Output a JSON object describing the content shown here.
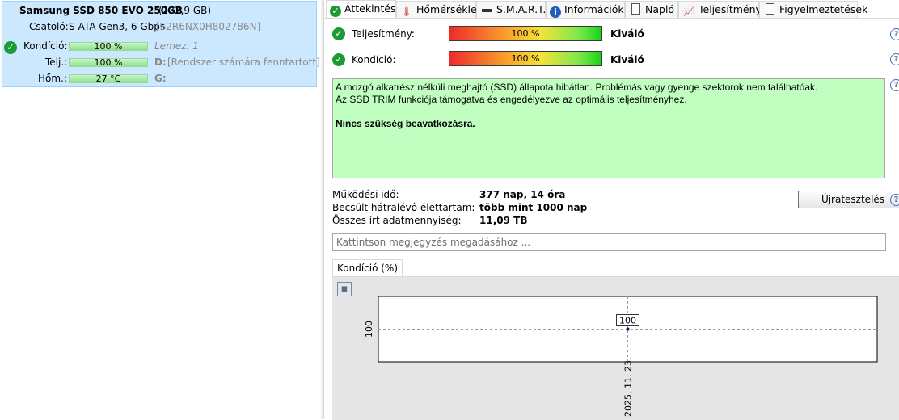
{
  "left_panel": {
    "disk_title": "Samsung SSD 850 EVO 250GB",
    "disk_size": "(232,9 GB)",
    "interface_label": "Csatoló:",
    "interface_value": "S-ATA Gen3, 6 Gbps",
    "serial": "[S2R6NX0H802786N]",
    "rows": [
      {
        "label": "Kondíció:",
        "bar": "100 %",
        "extra": "Lemez: 1",
        "level": 1.0
      },
      {
        "label": "Telj.:",
        "bar": "100 %",
        "extra_drive": "D:",
        "extra": "[Rendszer számára fenntartott],",
        "level": 1.0
      },
      {
        "label": "Hőm.:",
        "bar": "27 °C",
        "extra_drive": "G:",
        "level": 1.0
      }
    ]
  },
  "tabs": [
    {
      "label": "Áttekintés",
      "icon": "check-circle-icon"
    },
    {
      "label": "Hőmérséklet",
      "icon": "thermometer-icon"
    },
    {
      "label": "S.M.A.R.T.",
      "icon": "smart-drive-icon"
    },
    {
      "label": "Információk",
      "icon": "info-icon"
    },
    {
      "label": "Napló",
      "icon": "document-icon"
    },
    {
      "label": "Teljesítmény",
      "icon": "performance-chart-icon"
    },
    {
      "label": "Figyelmeztetések",
      "icon": "alerts-icon"
    }
  ],
  "overview": {
    "performance_label": "Teljesítmény:",
    "performance_value": "100 %",
    "performance_rating": "Kiváló",
    "performance_level": 1.0,
    "health_label": "Kondíció:",
    "health_value": "100 %",
    "health_rating": "Kiváló",
    "health_level": 1.0,
    "status_line1": "A mozgó alkatrész nélküli meghajtó (SSD) állapota hibátlan. Problémás vagy gyenge szektorok nem találhatóak.",
    "status_line2": "Az SSD TRIM funkciója támogatva és engedélyezve az optimális teljesítményhez.",
    "status_action": "Nincs szükség beavatkozásra.",
    "status_color": "#c0ffc0",
    "stats": [
      {
        "label": "Működési idő:",
        "value": "377 nap, 14 óra"
      },
      {
        "label": "Becsült hátralévő élettartam:",
        "value": "több mint 1000 nap"
      },
      {
        "label": "Összes írt adatmennyiség:",
        "value": "11,09 TB"
      }
    ],
    "retest_button": "Újratesztelés",
    "comment_placeholder": "Kattintson megjegyzés megadásához ...",
    "help_glyph": "?"
  },
  "chart_tab": "Kondíció  (%)",
  "chart_data": {
    "type": "line",
    "x": [
      "2025. 11. 23."
    ],
    "series": [
      {
        "values": [
          100
        ]
      }
    ],
    "ytick_labels": [
      "100"
    ],
    "data_labels": [
      "100"
    ],
    "grid": true
  }
}
